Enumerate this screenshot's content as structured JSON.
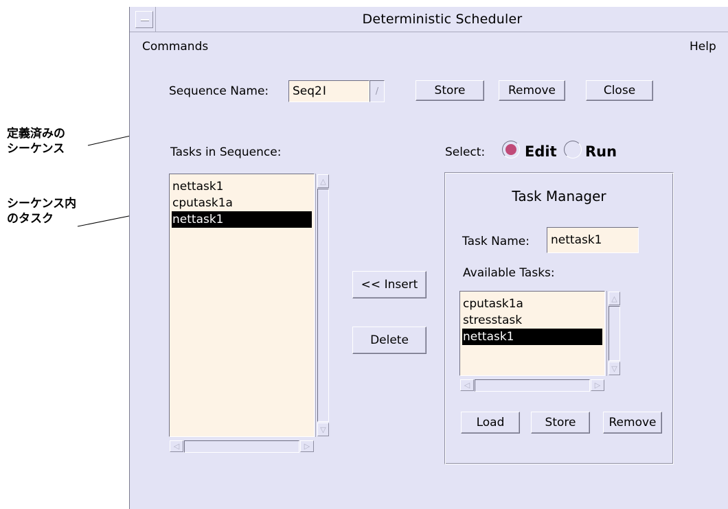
{
  "annotations": {
    "predefined_sequence": [
      "定義済みの",
      "シーケンス"
    ],
    "tasks_in_sequence": [
      "シーケンス内",
      "のタスク"
    ]
  },
  "window": {
    "title": "Deterministic Scheduler"
  },
  "menubar": {
    "commands": "Commands",
    "help": "Help"
  },
  "sequence": {
    "name_label": "Sequence Name:",
    "name_value": "Seq2",
    "store_label": "Store",
    "remove_label": "Remove",
    "close_label": "Close"
  },
  "tasks_in_sequence": {
    "label": "Tasks in Sequence:",
    "items": [
      "nettask1",
      "cputask1a",
      "nettask1"
    ],
    "selected_index": 2
  },
  "actions": {
    "insert_label": "<< Insert",
    "delete_label": "Delete"
  },
  "select": {
    "label": "Select:",
    "options": [
      "Edit",
      "Run"
    ],
    "selected": "Edit"
  },
  "task_manager": {
    "title": "Task Manager",
    "task_name_label": "Task Name:",
    "task_name_value": "nettask1",
    "available_label": "Available Tasks:",
    "available_items": [
      "cputask1a",
      "stresstask",
      "nettask1"
    ],
    "selected_index": 2,
    "load_label": "Load",
    "store_label": "Store",
    "remove_label": "Remove"
  },
  "colors": {
    "window_bg": "#e3e3f5",
    "field_bg": "#fdf3e6",
    "radio_on": "#c04a78",
    "selection_bg": "#000000"
  }
}
